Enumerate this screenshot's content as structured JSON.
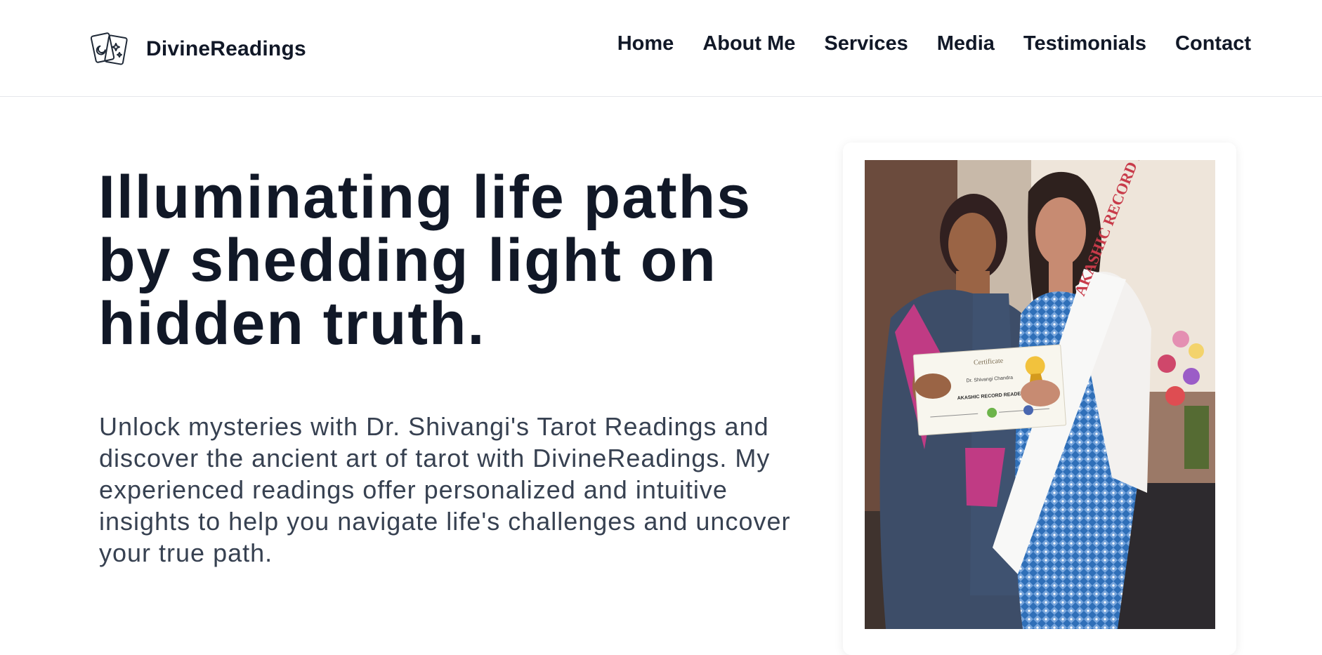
{
  "brand": {
    "name": "DivineReadings",
    "icon": "tarot-cards-icon"
  },
  "nav": {
    "items": [
      {
        "label": "Home"
      },
      {
        "label": "About Me"
      },
      {
        "label": "Services"
      },
      {
        "label": "Media"
      },
      {
        "label": "Testimonials"
      },
      {
        "label": "Contact"
      }
    ]
  },
  "hero": {
    "title": "Illuminating life paths by shedding light on hidden truth.",
    "description": "Unlock mysteries with Dr. Shivangi's Tarot Readings and discover the ancient art of tarot with DivineReadings. My experienced readings offer personalized and intuitive insights to help you navigate life's challenges and uncover your true path."
  },
  "photo": {
    "certificate": {
      "heading": "Certificate",
      "recipient": "Dr. Shivangi Chandra",
      "program": "AKASHIC RECORD READER"
    },
    "sash_text": "AKASHIC RECORD PRA"
  },
  "colors": {
    "text_dark": "#111827",
    "text_body": "#374151",
    "divider": "#e5e7eb"
  }
}
